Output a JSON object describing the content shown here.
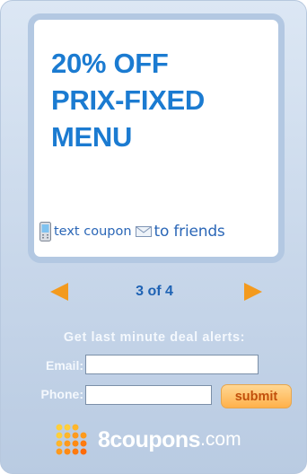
{
  "offer": {
    "headline_lines": [
      "20% OFF",
      "PRIX-FIXED",
      "MENU"
    ]
  },
  "share": {
    "text_coupon": "text coupon",
    "to_friends": "to friends"
  },
  "pager": {
    "label": "3 of 4"
  },
  "alerts": {
    "title": "Get last minute deal alerts:",
    "email_label": "Email:",
    "phone_label": "Phone:",
    "email_value": "",
    "phone_value": "",
    "submit_label": "submit"
  },
  "brand": {
    "name": "8coupons",
    "suffix": ".com"
  },
  "colors": {
    "headline": "#1b7bd1",
    "link": "#2b67b7",
    "arrow": "#f39a1e",
    "submit_bg": "#ffb14b"
  }
}
